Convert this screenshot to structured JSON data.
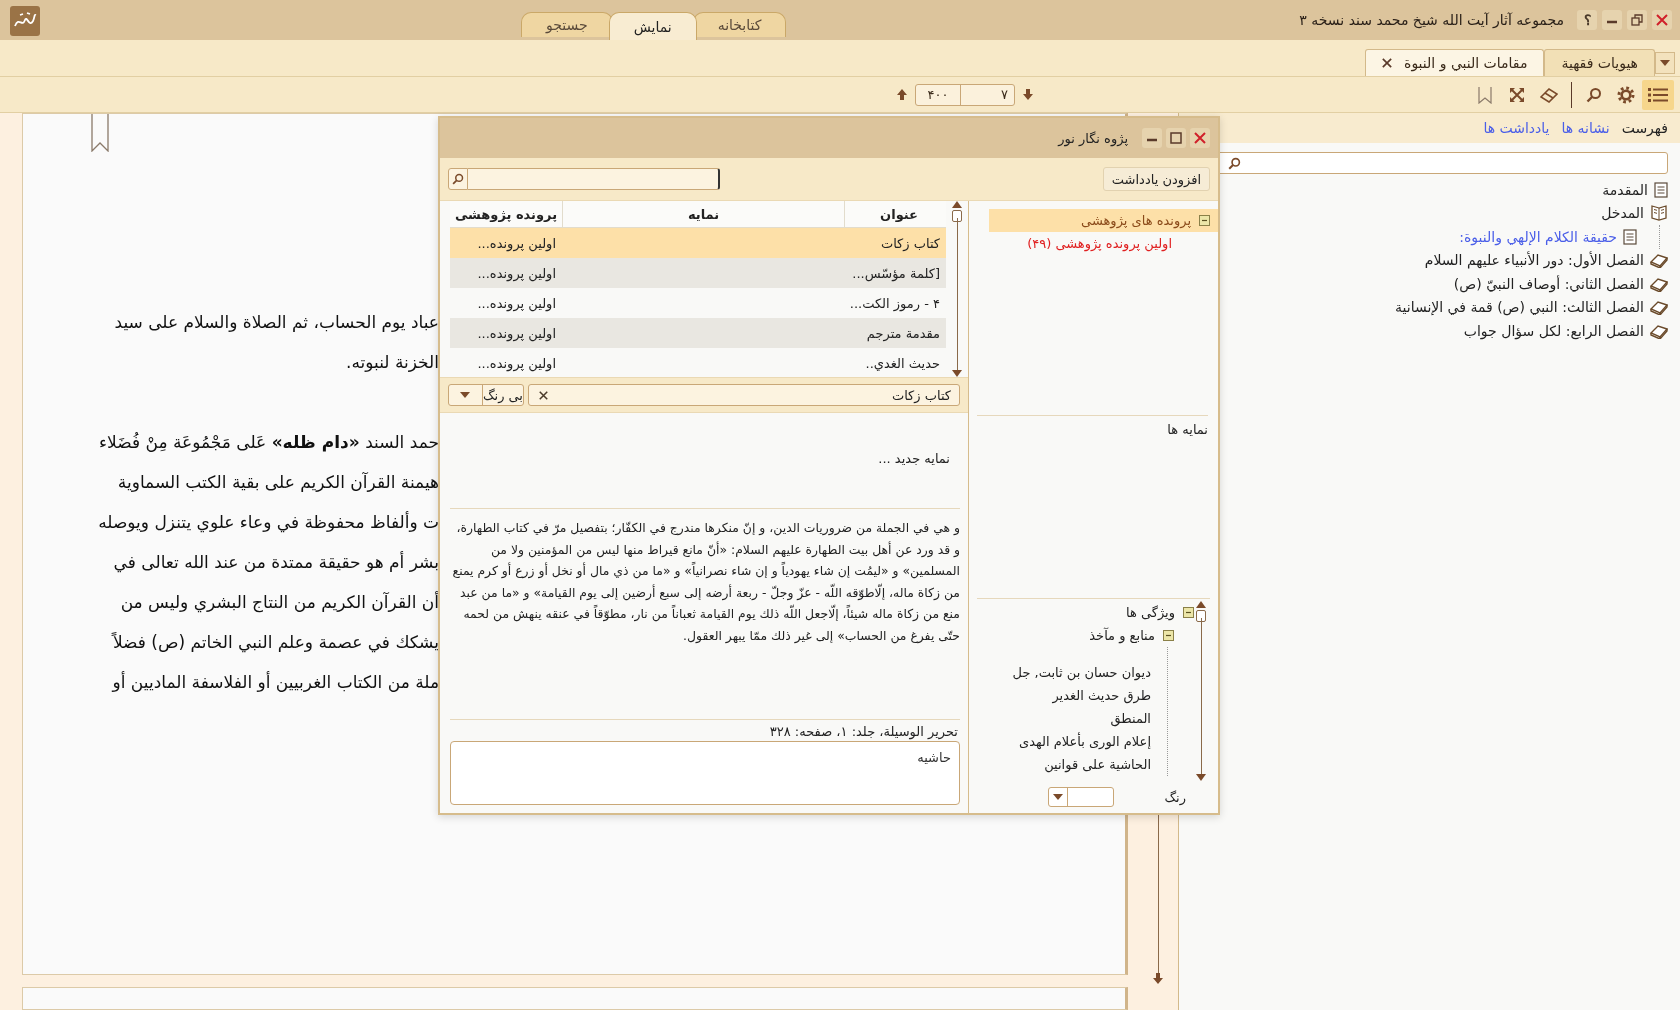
{
  "app": {
    "title": "مجموعه آثار آیت الله شیخ محمد سند نسخه ۳",
    "help": "؟"
  },
  "main_tabs": [
    {
      "label": "کتابخانه",
      "selected": false
    },
    {
      "label": "نمایش",
      "selected": true
    },
    {
      "label": "جستجو",
      "selected": false
    }
  ],
  "document_tabs": [
    {
      "label": "هیویات فقهیة",
      "selected": false,
      "closable": false
    },
    {
      "label": "مقامات النبي و النبوة",
      "selected": true,
      "closable": true
    }
  ],
  "page_nav": {
    "page": "۷",
    "total": "۴۰۰"
  },
  "toolbar": [
    {
      "kind": "list",
      "selected": true
    },
    {
      "kind": "settings",
      "selected": false
    },
    {
      "kind": "search",
      "selected": false
    },
    {
      "kind": "separator"
    },
    {
      "kind": "eraser",
      "selected": false
    },
    {
      "kind": "fullscreen",
      "selected": false
    },
    {
      "kind": "bookmark",
      "selected": false
    }
  ],
  "document": {
    "paragraphs": [
      {
        "lines": [
          "عباد يوم الحساب، ثم الصلاة والسلام على سيد",
          "الخزنة لنبوته."
        ]
      },
      {
        "lines": [
          "حمد السند **«دام ظله»** عَلى مَجْمُوعَة مِنْ فُضَلاء",
          "هيمنة القرآن الكريم على بقية الكتب السماوية",
          "ت وألفاظ محفوظة في وعاء علوي يتنزل ويوصله",
          "بشر أم هو حقيقة ممتدة من عند الله تعالى في",
          "أن القرآن الكريم من النتاج البشري وليس من",
          "يشكك في عصمة وعلم النبي الخاتم (ص) فضلاً",
          "ملة من الكتاب الغربيين أو الفلاسفة الماديين أو"
        ]
      }
    ]
  },
  "sidebar": {
    "tabs": [
      {
        "label": "فهرست",
        "selected": true
      },
      {
        "label": "نشانه ها",
        "selected": false
      },
      {
        "label": "یادداشت ها",
        "selected": false
      }
    ],
    "toc": [
      {
        "label": "المقدمة",
        "kind": "page"
      },
      {
        "label": "المدخل",
        "kind": "book",
        "expanded": true,
        "children": [
          {
            "label": "حقيقة الكلام الإلهي والنبوة:",
            "kind": "page",
            "selected": true
          }
        ]
      },
      {
        "label": "الفصل الأول: دور الأنبياء عليهم السلام",
        "kind": "book",
        "expanded": false
      },
      {
        "label": "الفصل الثاني: أوصاف النبيّ (ص)",
        "kind": "book",
        "expanded": false
      },
      {
        "label": "الفصل الثالث: النبي (ص) قمة في الإنسانية",
        "kind": "book",
        "expanded": false
      },
      {
        "label": "الفصل الرابع: لكل سؤال جواب",
        "kind": "book",
        "expanded": false
      }
    ]
  },
  "dialog": {
    "title": "پژوه نگار نور",
    "add_note": "افزودن یادداشت",
    "table": {
      "columns": [
        "عنوان",
        "نمایه",
        "پرونده پژوهشی"
      ],
      "rows": [
        {
          "title": "كتاب زكات",
          "file": "اولين پرونده...",
          "selected": true
        },
        {
          "title": "[كلمة مؤسّس...",
          "file": "اولين پرونده...",
          "selected": false
        },
        {
          "title": "۴ - رموز الكت...",
          "file": "اولين پرونده...",
          "selected": false
        },
        {
          "title": "مقدمة مترجم",
          "file": "اولين پرونده...",
          "selected": false
        },
        {
          "title": "حديث الغدي..",
          "file": "اولين پرونده...",
          "selected": false
        }
      ]
    },
    "tag": "كتاب زكات",
    "color_choice": "بی رنگ",
    "new_index_hint": "نمایه جدید ...",
    "quote": "و هي في الجملة من ضروريات الدين، و إنّ منكرها مندرج في الكفّار؛ بتفصيل مرّ في كتاب الطهارة، و قد ورد عن أهل بيت الطهارة عليهم السلام: «أنّ مانع قيراط منها ليس من المؤمنين ولا من المسلمين» و «ليمُت إن شاء يهودياً و إن شاء نصرانياً» و «ما من ذي مال أو نخل أو زرع أو كرم يمنع من زكاة ماله، إلّاطوّقه اللّه - عزّ وجلّ - ربعة أرضه إلى سبع أرضين إلى يوم القيامة» و «ما من عبد منع من زكاة ماله شيئاً، إلّاجعل اللّه ذلك يوم القيامة ثعباناً من نار، مطوّقاً في عنقه ينهش من لحمه حتّى يفرغ من الحساب» إلى غير ذلك ممّا يبهر العقول.",
    "source": "تحرير الوسيلة، جلد: ۱، صفحه: ۳۲۸",
    "note": {
      "placeholder": "حاشیه"
    },
    "files_tree": {
      "label": "پرونده های پژوهشی",
      "expanded": true,
      "selected": true,
      "children": [
        {
          "label": "اولين پرونده پژوهشی (۴۹)"
        }
      ]
    },
    "indexes_label": "نمایه ها",
    "properties_tree": {
      "label": "ویژگی ها",
      "expanded": true,
      "children": [
        {
          "label": "منابع و مآخذ",
          "expanded": true,
          "children": [
            {
              "label": "ديوان حسان بن ثابت, جل"
            },
            {
              "label": "طرق حديث الغدير"
            },
            {
              "label": "المنطق"
            },
            {
              "label": "إعلام الورى بأعلام الهدى"
            },
            {
              "label": "الحاشية على قوانين"
            }
          ]
        }
      ]
    },
    "color_label": "رنگ"
  }
}
